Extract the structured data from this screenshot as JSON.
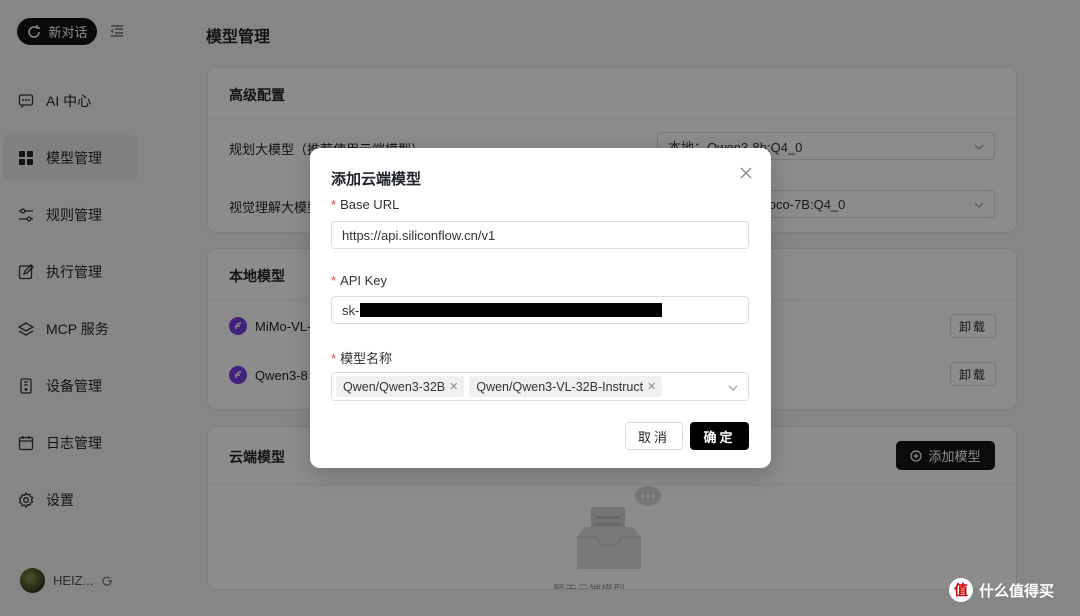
{
  "sidebar": {
    "new_chat_label": "新对话",
    "items": [
      {
        "label": "AI 中心",
        "icon": "chat-icon"
      },
      {
        "label": "模型管理",
        "icon": "grid-icon",
        "active": true
      },
      {
        "label": "规则管理",
        "icon": "sliders-icon"
      },
      {
        "label": "执行管理",
        "icon": "edit-icon"
      },
      {
        "label": "MCP 服务",
        "icon": "layers-icon"
      },
      {
        "label": "设备管理",
        "icon": "device-icon"
      },
      {
        "label": "日志管理",
        "icon": "calendar-icon"
      },
      {
        "label": "设置",
        "icon": "gear-icon"
      }
    ],
    "user_name": "HEIZ..."
  },
  "main": {
    "page_title": "模型管理",
    "advanced": {
      "title": "高级配置",
      "planning_label": "规划大模型（推荐使用云端模型）",
      "planning_value": "本地：Qwen3-8b:Q4_0",
      "vision_label": "视觉理解大模型",
      "vision_value": "iloco-7B:Q4_0"
    },
    "local": {
      "title": "本地模型",
      "models": [
        {
          "name": "MiMo-VL-",
          "action": "卸载"
        },
        {
          "name": "Qwen3-8",
          "action": "卸载"
        }
      ]
    },
    "cloud": {
      "title": "云端模型",
      "add_label": "添加模型",
      "empty_text": "暂无云端模型"
    }
  },
  "modal": {
    "title": "添加云端模型",
    "base_url_label": "Base URL",
    "base_url_value": "https://api.siliconflow.cn/v1",
    "api_key_label": "API Key",
    "api_key_prefix": "sk-",
    "model_name_label": "模型名称",
    "model_tags": [
      "Qwen/Qwen3-32B",
      "Qwen/Qwen3-VL-32B-Instruct"
    ],
    "cancel_label": "取消",
    "ok_label": "确定"
  },
  "watermark": {
    "logo_char": "值",
    "text": "什么值得买"
  }
}
